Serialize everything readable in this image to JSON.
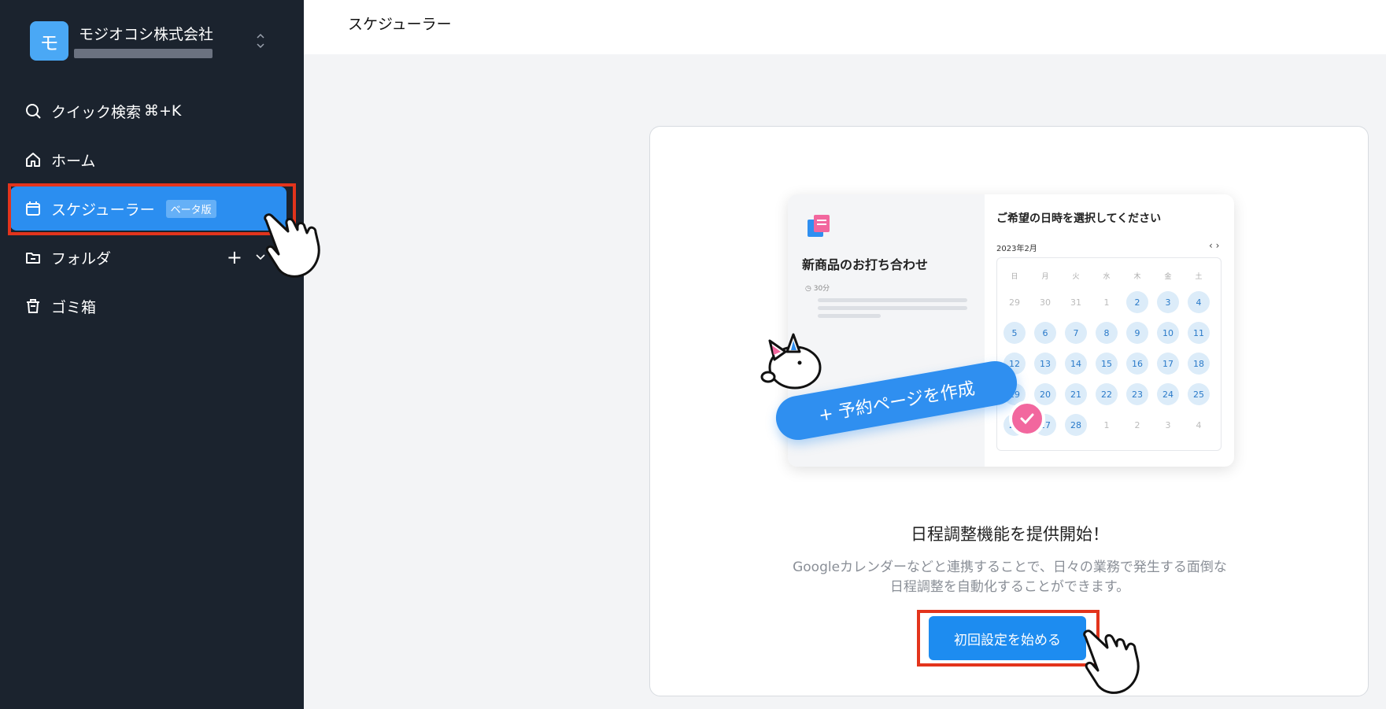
{
  "org": {
    "avatar_letter": "モ",
    "name": "モジオコシ株式会社"
  },
  "nav": {
    "search_label": "クイック検索",
    "search_shortcut": "⌘+K",
    "home_label": "ホーム",
    "scheduler_label": "スケジューラー",
    "scheduler_badge": "ベータ版",
    "folder_label": "フォルダ",
    "folder_add": "+",
    "trash_label": "ゴミ箱"
  },
  "header": {
    "title": "スケジューラー"
  },
  "illustration": {
    "meeting_title": "新商品のお打ち合わせ",
    "duration": "30分",
    "picker_title": "ご希望の日時を選択してください",
    "month": "2023年2月",
    "weekdays": [
      "日",
      "月",
      "火",
      "水",
      "木",
      "金",
      "土"
    ],
    "weeks": [
      [
        "29",
        "30",
        "31",
        "1",
        "2",
        "3",
        "4"
      ],
      [
        "5",
        "6",
        "7",
        "8",
        "9",
        "10",
        "11"
      ],
      [
        "12",
        "13",
        "14",
        "15",
        "16",
        "17",
        "18"
      ],
      [
        "19",
        "20",
        "21",
        "22",
        "23",
        "24",
        "25"
      ],
      [
        "26",
        "27",
        "28",
        "1",
        "2",
        "3",
        "4"
      ]
    ],
    "create_button": "+ 予約ページを作成"
  },
  "promo": {
    "headline": "日程調整機能を提供開始！",
    "description_line1": "Googleカレンダーなどと連携することで、日々の業務で発生する面倒な",
    "description_line2": "日程調整を自動化することができます。",
    "start_button": "初回設定を始める"
  },
  "colors": {
    "sidebar_bg": "#1b232e",
    "accent": "#2b8ef0",
    "highlight": "#e3341c"
  }
}
